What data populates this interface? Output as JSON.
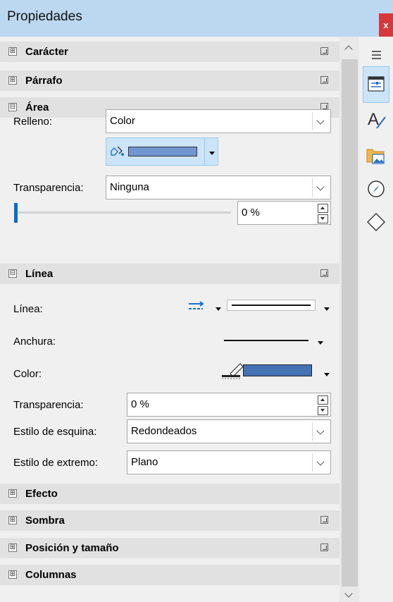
{
  "window": {
    "title": "Propiedades",
    "close": "x"
  },
  "sections": {
    "caracter": "Carácter",
    "parrafo": "Párrafo",
    "area": "Área",
    "linea": "Línea",
    "efecto": "Efecto",
    "sombra": "Sombra",
    "posicion": "Posición y tamaño",
    "columnas": "Columnas"
  },
  "area": {
    "fill_label": "Relleno:",
    "fill_value": "Color",
    "fill_color": "#7095cf",
    "transparency_label": "Transparencia:",
    "transparency_value": "Ninguna",
    "transparency_percent": "0 %"
  },
  "line": {
    "line_label": "Línea:",
    "width_label": "Anchura:",
    "color_label": "Color:",
    "line_color": "#4472b4",
    "transparency_label": "Transparencia:",
    "transparency_value": "0 %",
    "corner_label": "Estilo de esquina:",
    "corner_value": "Redondeados",
    "end_label": "Estilo de extremo:",
    "end_value": "Plano"
  },
  "expander_icons": {
    "collapsed": "⊞",
    "expanded": "⊟"
  },
  "tabs": [
    "menu-icon",
    "properties-icon",
    "styles-icon",
    "gallery-icon",
    "navigator-icon",
    "shapes-icon"
  ],
  "colors": {
    "accent": "#0b6bcb",
    "title_bar": "#bcd8f1",
    "close": "#d9383a"
  }
}
